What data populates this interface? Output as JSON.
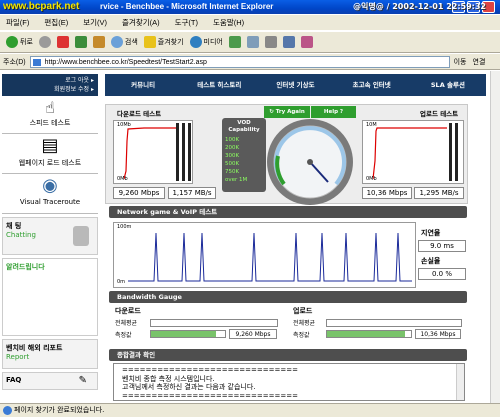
{
  "browser": {
    "watermark": "www.bcpark.net",
    "title": "rvice - Benchbee - Microsoft Internet Explorer",
    "menu": [
      "파일(F)",
      "편집(E)",
      "보기(V)",
      "즐겨찾기(A)",
      "도구(T)",
      "도움말(H)"
    ],
    "toolbar": {
      "back": "뒤로",
      "search": "검색",
      "favorites": "즐겨찾기",
      "media": "미디어"
    },
    "address_label": "주소(D)",
    "url": "http://www.benchbee.co.kr/Speedtest/TestStart2.asp",
    "go": "이동",
    "links": "연결",
    "status": "페이지 찾기가 완료되었습니다.",
    "status_overlay": "@익명@ / 2002-12-01 22:59:32"
  },
  "leftnav": {
    "top_btn1": "로그 아웃 ▸",
    "top_btn2": "회원정보 수정 ▸",
    "items": [
      "스피드 테스트",
      "웹페이지 로드 테스트",
      "Visual Traceroute"
    ],
    "chat_title": "채 팅",
    "chat_sub": "Chatting",
    "notice": "알려드립니다",
    "report_title": "벤치비 해외 리포트",
    "report_sub": "Report",
    "faq": "FAQ"
  },
  "topnav": [
    "커뮤니티",
    "테스트 히스토리",
    "인터넷 기상도",
    "초고속 인터넷",
    "SLA 솔루션"
  ],
  "speed": {
    "down_title": "다운로드 테스트",
    "up_title": "업로드 테스트",
    "down_max": "10Mb",
    "up_max": "10M",
    "zero": "0Mb",
    "down_mbps": "9,260 Mbps",
    "down_mbs": "1,157 MB/s",
    "up_mbps": "10,36 Mbps",
    "up_mbs": "1,295 MB/s",
    "vod_title": "VOD Capability",
    "vod_levels": [
      "100K",
      "200K",
      "300K",
      "500K",
      "750K",
      "over 1M"
    ],
    "try_again": "Try Again",
    "help": "Help"
  },
  "game": {
    "section": "Network game & VoIP 테스트",
    "ymax": "100m",
    "yzero": "0m",
    "latency_label": "지연율",
    "latency": "9.0 ms",
    "loss_label": "손실율",
    "loss": "0.0 %"
  },
  "gauge": {
    "section": "Bandwidth Gauge",
    "down_label": "다운로드",
    "up_label": "업로드",
    "avg_label": "전체평균",
    "measured_label": "측정값",
    "down_measured": "9,260 Mbps",
    "up_measured": "10,36 Mbps",
    "down_fill": 0.88,
    "up_fill": 0.93
  },
  "result": {
    "section": "종합결과 확인",
    "lines": [
      "==============================",
      "벤치비 종합 측정 시스템입니다.",
      "고객님께서 측정하신 결과는 다음과 같습니다.",
      "=============================="
    ]
  },
  "colors": {
    "navy": "#173b67",
    "accent_green": "#2f9e2f",
    "bar_green": "#79c36a"
  }
}
